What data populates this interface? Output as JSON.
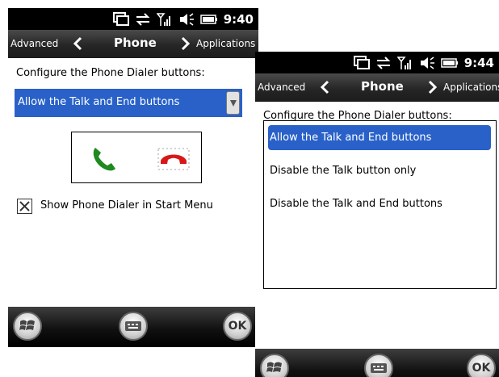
{
  "screens": [
    {
      "time": "9:40",
      "nav": {
        "prev": "Advanced",
        "title": "Phone",
        "next": "Applications"
      },
      "label": "Configure the Phone Dialer buttons:",
      "dropdown_value": "Allow the Talk and End buttons",
      "checkbox_label": "Show Phone Dialer in Start Menu",
      "checkbox_checked": true,
      "ok_label": "OK"
    },
    {
      "time": "9:44",
      "nav": {
        "prev": "Advanced",
        "title": "Phone",
        "next": "Applications"
      },
      "label": "Configure the Phone Dialer buttons:",
      "options": [
        "Allow the Talk and End buttons",
        "Disable the Talk button only",
        "Disable the Talk and End buttons"
      ],
      "selected_option": 0,
      "ok_label": "OK"
    }
  ],
  "icons": [
    "sync-icon",
    "activesync-icon",
    "signal-icon",
    "volume-icon",
    "battery-icon",
    "talk-phone-icon",
    "end-phone-icon",
    "windows-start-icon",
    "keyboard-icon"
  ],
  "colors": {
    "selection": "#2961c8",
    "talk": "#1f8a1f",
    "end": "#d81818"
  }
}
